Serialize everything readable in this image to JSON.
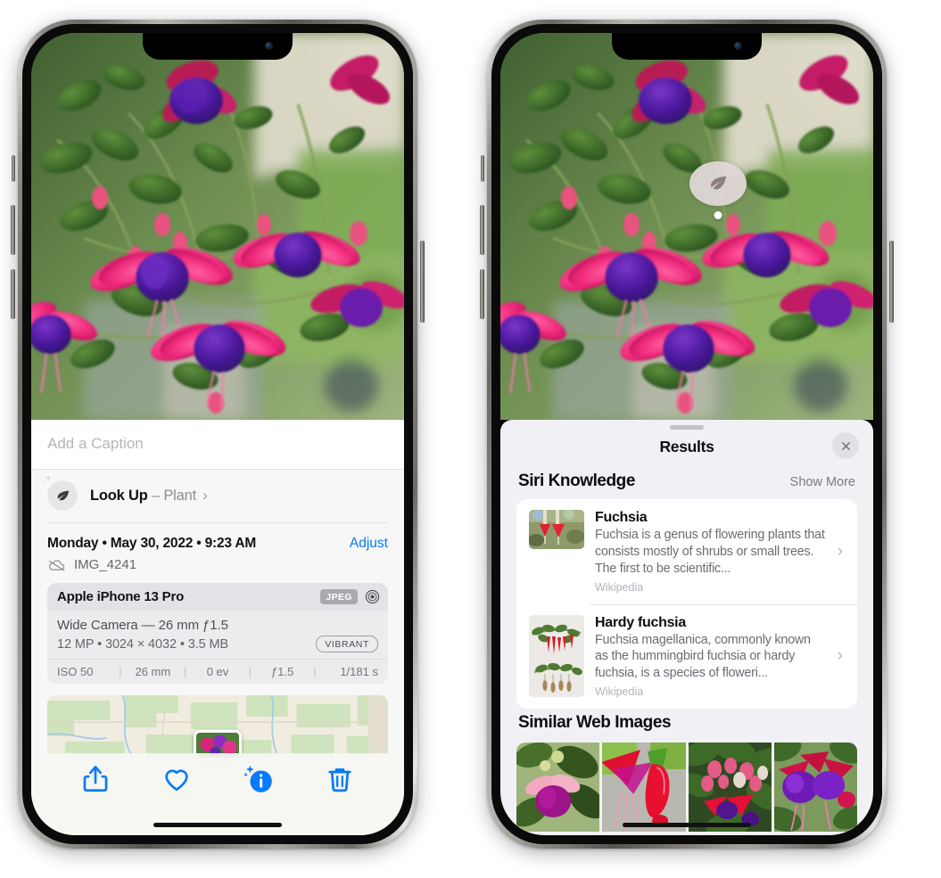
{
  "left_phone": {
    "photo_alt": "fuchsia-flowers-photo",
    "caption_placeholder": "Add a Caption",
    "lookup": {
      "label": "Look Up",
      "dash": "–",
      "subject": "Plant",
      "chevron": "›",
      "icon": "leaf-icon",
      "sparkle_icon": "sparkle-icon"
    },
    "date_line": "Monday • May 30, 2022 • 9:23 AM",
    "adjust_label": "Adjust",
    "filename": "IMG_4241",
    "cloud_icon": "cloud-slash-icon",
    "camera": {
      "model": "Apple iPhone 13 Pro",
      "format_tag": "JPEG",
      "raw_icon": "aperture-icon",
      "lens_line": "Wide Camera — 26 mm ƒ1.5",
      "specs_line": "12 MP • 3024 × 4032 • 3.5 MB",
      "style_tag": "VIBRANT",
      "exif": [
        {
          "label": "ISO 50"
        },
        {
          "label": "26 mm"
        },
        {
          "label": "0 ev"
        },
        {
          "label": "ƒ1.5"
        },
        {
          "label": "1/181 s"
        }
      ]
    },
    "toolbar": [
      {
        "name": "share-button",
        "icon": "share-icon"
      },
      {
        "name": "favorite-button",
        "icon": "heart-icon"
      },
      {
        "name": "info-button",
        "icon": "info-sparkle-icon"
      },
      {
        "name": "delete-button",
        "icon": "trash-icon"
      }
    ]
  },
  "right_phone": {
    "photo_alt": "fuchsia-flowers-photo",
    "photo_pill_icon": "leaf-icon",
    "sheet": {
      "title": "Results",
      "close_icon": "close-icon",
      "sections": [
        {
          "title": "Siri Knowledge",
          "action": "Show More",
          "items": [
            {
              "title": "Fuchsia",
              "description": "Fuchsia is a genus of flowering plants that consists mostly of shrubs or small trees. The first to be scientific...",
              "source": "Wikipedia",
              "thumb": "fuchsia-red-flowers-thumb",
              "chevron": "›"
            },
            {
              "title": "Hardy fuchsia",
              "description": "Fuchsia magellanica, commonly known as the hummingbird fuchsia or hardy fuchsia, is a species of floweri...",
              "source": "Wikipedia",
              "thumb": "hardy-fuchsia-specimen-thumb",
              "chevron": "›"
            }
          ]
        },
        {
          "title": "Similar Web Images",
          "action": "",
          "images": [
            {
              "name": "web-image-1"
            },
            {
              "name": "web-image-2"
            },
            {
              "name": "web-image-3"
            },
            {
              "name": "web-image-4"
            }
          ]
        }
      ]
    }
  },
  "colors": {
    "accent_blue": "#047aff",
    "sheet_bg": "#f1f1f5",
    "card_bg": "#ffffff",
    "secondary_text": "#8e8e93",
    "toolbar_bg": "#f7f8f1"
  }
}
